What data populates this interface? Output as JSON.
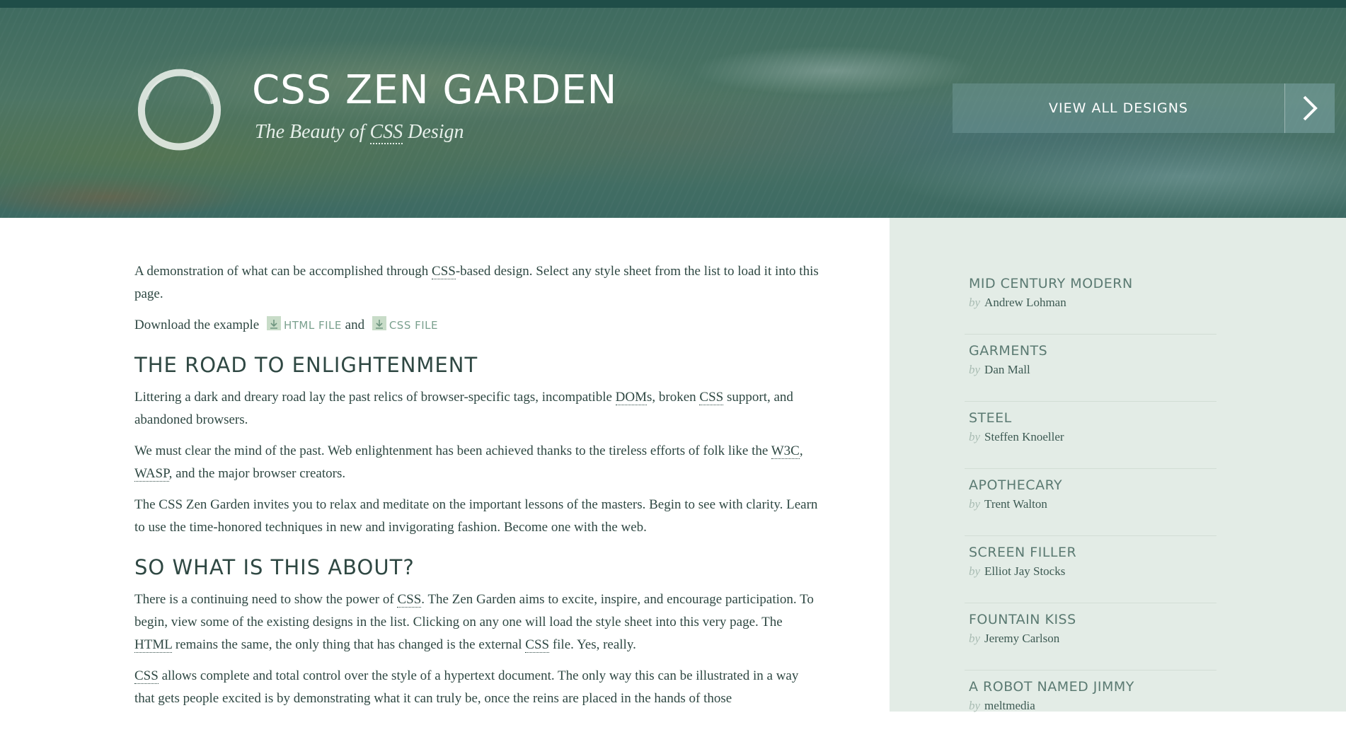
{
  "header": {
    "title": "CSS ZEN GARDEN",
    "tagline_prefix": "The Beauty of ",
    "tagline_abbr": "CSS",
    "tagline_suffix": " Design",
    "view_all_label": "VIEW ALL DESIGNS"
  },
  "intro": {
    "p1_a": "A demonstration of what can be accomplished through ",
    "p1_abbr": "CSS",
    "p1_b": "-based design. Select any style sheet from the list to load it into this page.",
    "download_prefix": "Download the example ",
    "html_file": "HTML FILE",
    "and": " and ",
    "css_file": "CSS FILE"
  },
  "sections": {
    "road_title": "THE ROAD TO ENLIGHTENMENT",
    "road_p1_a": "Littering a dark and dreary road lay the past relics of browser-specific tags, incompatible ",
    "road_p1_doms": "DOM",
    "road_p1_b": "s, broken ",
    "road_p1_css": "CSS",
    "road_p1_c": " support, and abandoned browsers.",
    "road_p2_a": "We must clear the mind of the past. Web enlightenment has been achieved thanks to the tireless efforts of folk like the ",
    "road_p2_w3c": "W3C",
    "road_p2_sep": ", ",
    "road_p2_wasp": "WASP",
    "road_p2_b": ", and the major browser creators.",
    "road_p3": "The CSS Zen Garden invites you to relax and meditate on the important lessons of the masters. Begin to see with clarity. Learn to use the time-honored techniques in new and invigorating fashion. Become one with the web.",
    "about_title": "SO WHAT IS THIS ABOUT?",
    "about_p1_a": "There is a continuing need to show the power of ",
    "about_p1_css": "CSS",
    "about_p1_b": ". The Zen Garden aims to excite, inspire, and encourage participation. To begin, view some of the existing designs in the list. Clicking on any one will load the style sheet into this very page. The ",
    "about_p1_html": "HTML",
    "about_p1_c": " remains the same, the only thing that has changed is the external ",
    "about_p1_css2": "CSS",
    "about_p1_d": " file. Yes, really.",
    "about_p2_css": "CSS",
    "about_p2_a": " allows complete and total control over the style of a hypertext document. The only way this can be illustrated in a way that gets people excited is by demonstrating what it can truly be, once the reins are placed in the hands of those"
  },
  "sidebar": {
    "by_label": "by",
    "designs": [
      {
        "name": "MID CENTURY MODERN",
        "author": "Andrew Lohman"
      },
      {
        "name": "GARMENTS",
        "author": "Dan Mall"
      },
      {
        "name": "STEEL",
        "author": "Steffen Knoeller"
      },
      {
        "name": "APOTHECARY",
        "author": "Trent Walton"
      },
      {
        "name": "SCREEN FILLER",
        "author": "Elliot Jay Stocks"
      },
      {
        "name": "FOUNTAIN KISS",
        "author": "Jeremy Carlson"
      },
      {
        "name": "A ROBOT NAMED JIMMY",
        "author": "meltmedia"
      }
    ]
  },
  "colors": {
    "header_dark": "#1f4d48",
    "sidebar_bg": "#e3ece6",
    "text": "#2f4843",
    "link_green": "#7aa08e"
  },
  "icons": [
    "enso-logo-icon",
    "chevron-right-icon",
    "download-icon"
  ]
}
